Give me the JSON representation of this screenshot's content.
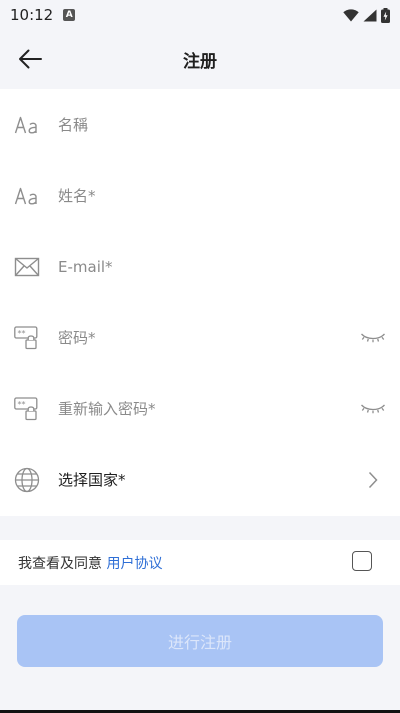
{
  "status_bar": {
    "time": "10:12",
    "notification_badge": "A"
  },
  "header": {
    "title": "注册"
  },
  "form": {
    "nickname": {
      "placeholder": "名稱"
    },
    "full_name": {
      "placeholder": "姓名*"
    },
    "email": {
      "placeholder": "E-mail*"
    },
    "password": {
      "placeholder": "密码*"
    },
    "confirm_password": {
      "placeholder": "重新输入密码*"
    },
    "country": {
      "label": "选择国家*"
    }
  },
  "agreement": {
    "prefix": "我查看及同意 ",
    "link": "用户协议"
  },
  "submit": {
    "label": "进行注册"
  },
  "colors": {
    "accent_link": "#2f6fd6",
    "button_disabled": "#a9c4f5"
  }
}
